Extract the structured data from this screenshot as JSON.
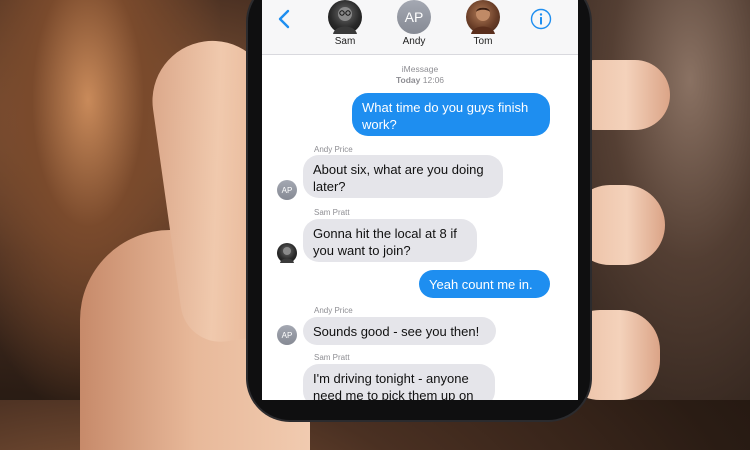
{
  "header": {
    "contacts": [
      {
        "name": "Sam",
        "initials": ""
      },
      {
        "name": "Andy",
        "initials": "AP"
      },
      {
        "name": "Tom",
        "initials": ""
      }
    ]
  },
  "thread": {
    "service": "iMessage",
    "timestamp_day": "Today",
    "timestamp_time": "12:06",
    "messages": [
      {
        "direction": "sent",
        "text_lines": [
          "What time do you guys finish",
          "work?"
        ]
      },
      {
        "direction": "received",
        "sender": "Andy Price",
        "avatar_initials": "AP",
        "text_lines": [
          "About six, what are you doing",
          "later?"
        ]
      },
      {
        "direction": "received",
        "sender": "Sam Pratt",
        "avatar_initials": "",
        "text_lines": [
          "Gonna hit the local at 8 if",
          "you want to join?"
        ]
      },
      {
        "direction": "sent",
        "text_lines": [
          "Yeah count me in."
        ]
      },
      {
        "direction": "received",
        "sender": "Andy Price",
        "avatar_initials": "AP",
        "text_lines": [
          "Sounds good - see you then!"
        ]
      },
      {
        "direction": "received",
        "sender": "Sam Pratt",
        "avatar_initials": "",
        "text_lines": [
          "I'm driving tonight - anyone",
          "need me to pick them up on"
        ]
      }
    ]
  },
  "colors": {
    "sent_bubble": "#1e8ef0",
    "received_bubble": "#e5e5ea",
    "accent": "#1e8ef0"
  }
}
